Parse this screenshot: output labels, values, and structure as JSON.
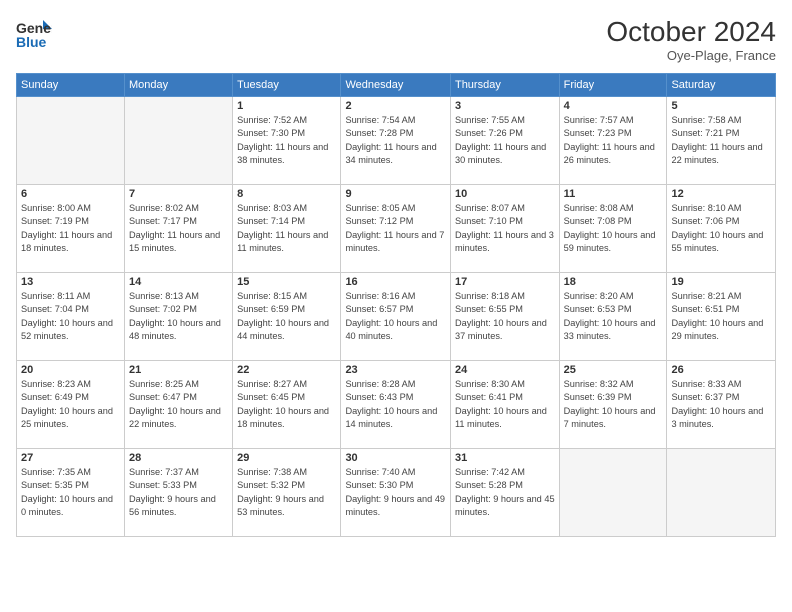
{
  "header": {
    "logo_line1": "General",
    "logo_line2": "Blue",
    "month": "October 2024",
    "location": "Oye-Plage, France"
  },
  "days_of_week": [
    "Sunday",
    "Monday",
    "Tuesday",
    "Wednesday",
    "Thursday",
    "Friday",
    "Saturday"
  ],
  "weeks": [
    [
      {
        "day": "",
        "info": ""
      },
      {
        "day": "",
        "info": ""
      },
      {
        "day": "1",
        "info": "Sunrise: 7:52 AM\nSunset: 7:30 PM\nDaylight: 11 hours and 38 minutes."
      },
      {
        "day": "2",
        "info": "Sunrise: 7:54 AM\nSunset: 7:28 PM\nDaylight: 11 hours and 34 minutes."
      },
      {
        "day": "3",
        "info": "Sunrise: 7:55 AM\nSunset: 7:26 PM\nDaylight: 11 hours and 30 minutes."
      },
      {
        "day": "4",
        "info": "Sunrise: 7:57 AM\nSunset: 7:23 PM\nDaylight: 11 hours and 26 minutes."
      },
      {
        "day": "5",
        "info": "Sunrise: 7:58 AM\nSunset: 7:21 PM\nDaylight: 11 hours and 22 minutes."
      }
    ],
    [
      {
        "day": "6",
        "info": "Sunrise: 8:00 AM\nSunset: 7:19 PM\nDaylight: 11 hours and 18 minutes."
      },
      {
        "day": "7",
        "info": "Sunrise: 8:02 AM\nSunset: 7:17 PM\nDaylight: 11 hours and 15 minutes."
      },
      {
        "day": "8",
        "info": "Sunrise: 8:03 AM\nSunset: 7:14 PM\nDaylight: 11 hours and 11 minutes."
      },
      {
        "day": "9",
        "info": "Sunrise: 8:05 AM\nSunset: 7:12 PM\nDaylight: 11 hours and 7 minutes."
      },
      {
        "day": "10",
        "info": "Sunrise: 8:07 AM\nSunset: 7:10 PM\nDaylight: 11 hours and 3 minutes."
      },
      {
        "day": "11",
        "info": "Sunrise: 8:08 AM\nSunset: 7:08 PM\nDaylight: 10 hours and 59 minutes."
      },
      {
        "day": "12",
        "info": "Sunrise: 8:10 AM\nSunset: 7:06 PM\nDaylight: 10 hours and 55 minutes."
      }
    ],
    [
      {
        "day": "13",
        "info": "Sunrise: 8:11 AM\nSunset: 7:04 PM\nDaylight: 10 hours and 52 minutes."
      },
      {
        "day": "14",
        "info": "Sunrise: 8:13 AM\nSunset: 7:02 PM\nDaylight: 10 hours and 48 minutes."
      },
      {
        "day": "15",
        "info": "Sunrise: 8:15 AM\nSunset: 6:59 PM\nDaylight: 10 hours and 44 minutes."
      },
      {
        "day": "16",
        "info": "Sunrise: 8:16 AM\nSunset: 6:57 PM\nDaylight: 10 hours and 40 minutes."
      },
      {
        "day": "17",
        "info": "Sunrise: 8:18 AM\nSunset: 6:55 PM\nDaylight: 10 hours and 37 minutes."
      },
      {
        "day": "18",
        "info": "Sunrise: 8:20 AM\nSunset: 6:53 PM\nDaylight: 10 hours and 33 minutes."
      },
      {
        "day": "19",
        "info": "Sunrise: 8:21 AM\nSunset: 6:51 PM\nDaylight: 10 hours and 29 minutes."
      }
    ],
    [
      {
        "day": "20",
        "info": "Sunrise: 8:23 AM\nSunset: 6:49 PM\nDaylight: 10 hours and 25 minutes."
      },
      {
        "day": "21",
        "info": "Sunrise: 8:25 AM\nSunset: 6:47 PM\nDaylight: 10 hours and 22 minutes."
      },
      {
        "day": "22",
        "info": "Sunrise: 8:27 AM\nSunset: 6:45 PM\nDaylight: 10 hours and 18 minutes."
      },
      {
        "day": "23",
        "info": "Sunrise: 8:28 AM\nSunset: 6:43 PM\nDaylight: 10 hours and 14 minutes."
      },
      {
        "day": "24",
        "info": "Sunrise: 8:30 AM\nSunset: 6:41 PM\nDaylight: 10 hours and 11 minutes."
      },
      {
        "day": "25",
        "info": "Sunrise: 8:32 AM\nSunset: 6:39 PM\nDaylight: 10 hours and 7 minutes."
      },
      {
        "day": "26",
        "info": "Sunrise: 8:33 AM\nSunset: 6:37 PM\nDaylight: 10 hours and 3 minutes."
      }
    ],
    [
      {
        "day": "27",
        "info": "Sunrise: 7:35 AM\nSunset: 5:35 PM\nDaylight: 10 hours and 0 minutes."
      },
      {
        "day": "28",
        "info": "Sunrise: 7:37 AM\nSunset: 5:33 PM\nDaylight: 9 hours and 56 minutes."
      },
      {
        "day": "29",
        "info": "Sunrise: 7:38 AM\nSunset: 5:32 PM\nDaylight: 9 hours and 53 minutes."
      },
      {
        "day": "30",
        "info": "Sunrise: 7:40 AM\nSunset: 5:30 PM\nDaylight: 9 hours and 49 minutes."
      },
      {
        "day": "31",
        "info": "Sunrise: 7:42 AM\nSunset: 5:28 PM\nDaylight: 9 hours and 45 minutes."
      },
      {
        "day": "",
        "info": ""
      },
      {
        "day": "",
        "info": ""
      }
    ]
  ]
}
